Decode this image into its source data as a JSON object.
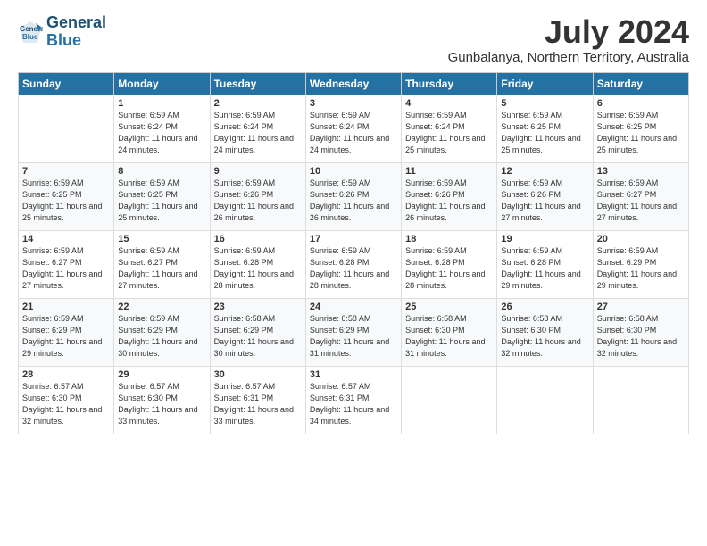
{
  "logo": {
    "line1": "General",
    "line2": "Blue"
  },
  "title": "July 2024",
  "subtitle": "Gunbalanya, Northern Territory, Australia",
  "calendar": {
    "headers": [
      "Sunday",
      "Monday",
      "Tuesday",
      "Wednesday",
      "Thursday",
      "Friday",
      "Saturday"
    ],
    "weeks": [
      [
        {
          "day": "",
          "detail": ""
        },
        {
          "day": "1",
          "detail": "Sunrise: 6:59 AM\nSunset: 6:24 PM\nDaylight: 11 hours\nand 24 minutes."
        },
        {
          "day": "2",
          "detail": "Sunrise: 6:59 AM\nSunset: 6:24 PM\nDaylight: 11 hours\nand 24 minutes."
        },
        {
          "day": "3",
          "detail": "Sunrise: 6:59 AM\nSunset: 6:24 PM\nDaylight: 11 hours\nand 24 minutes."
        },
        {
          "day": "4",
          "detail": "Sunrise: 6:59 AM\nSunset: 6:24 PM\nDaylight: 11 hours\nand 25 minutes."
        },
        {
          "day": "5",
          "detail": "Sunrise: 6:59 AM\nSunset: 6:25 PM\nDaylight: 11 hours\nand 25 minutes."
        },
        {
          "day": "6",
          "detail": "Sunrise: 6:59 AM\nSunset: 6:25 PM\nDaylight: 11 hours\nand 25 minutes."
        }
      ],
      [
        {
          "day": "7",
          "detail": "Sunrise: 6:59 AM\nSunset: 6:25 PM\nDaylight: 11 hours\nand 25 minutes."
        },
        {
          "day": "8",
          "detail": "Sunrise: 6:59 AM\nSunset: 6:25 PM\nDaylight: 11 hours\nand 25 minutes."
        },
        {
          "day": "9",
          "detail": "Sunrise: 6:59 AM\nSunset: 6:26 PM\nDaylight: 11 hours\nand 26 minutes."
        },
        {
          "day": "10",
          "detail": "Sunrise: 6:59 AM\nSunset: 6:26 PM\nDaylight: 11 hours\nand 26 minutes."
        },
        {
          "day": "11",
          "detail": "Sunrise: 6:59 AM\nSunset: 6:26 PM\nDaylight: 11 hours\nand 26 minutes."
        },
        {
          "day": "12",
          "detail": "Sunrise: 6:59 AM\nSunset: 6:26 PM\nDaylight: 11 hours\nand 27 minutes."
        },
        {
          "day": "13",
          "detail": "Sunrise: 6:59 AM\nSunset: 6:27 PM\nDaylight: 11 hours\nand 27 minutes."
        }
      ],
      [
        {
          "day": "14",
          "detail": "Sunrise: 6:59 AM\nSunset: 6:27 PM\nDaylight: 11 hours\nand 27 minutes."
        },
        {
          "day": "15",
          "detail": "Sunrise: 6:59 AM\nSunset: 6:27 PM\nDaylight: 11 hours\nand 27 minutes."
        },
        {
          "day": "16",
          "detail": "Sunrise: 6:59 AM\nSunset: 6:28 PM\nDaylight: 11 hours\nand 28 minutes."
        },
        {
          "day": "17",
          "detail": "Sunrise: 6:59 AM\nSunset: 6:28 PM\nDaylight: 11 hours\nand 28 minutes."
        },
        {
          "day": "18",
          "detail": "Sunrise: 6:59 AM\nSunset: 6:28 PM\nDaylight: 11 hours\nand 28 minutes."
        },
        {
          "day": "19",
          "detail": "Sunrise: 6:59 AM\nSunset: 6:28 PM\nDaylight: 11 hours\nand 29 minutes."
        },
        {
          "day": "20",
          "detail": "Sunrise: 6:59 AM\nSunset: 6:29 PM\nDaylight: 11 hours\nand 29 minutes."
        }
      ],
      [
        {
          "day": "21",
          "detail": "Sunrise: 6:59 AM\nSunset: 6:29 PM\nDaylight: 11 hours\nand 29 minutes."
        },
        {
          "day": "22",
          "detail": "Sunrise: 6:59 AM\nSunset: 6:29 PM\nDaylight: 11 hours\nand 30 minutes."
        },
        {
          "day": "23",
          "detail": "Sunrise: 6:58 AM\nSunset: 6:29 PM\nDaylight: 11 hours\nand 30 minutes."
        },
        {
          "day": "24",
          "detail": "Sunrise: 6:58 AM\nSunset: 6:29 PM\nDaylight: 11 hours\nand 31 minutes."
        },
        {
          "day": "25",
          "detail": "Sunrise: 6:58 AM\nSunset: 6:30 PM\nDaylight: 11 hours\nand 31 minutes."
        },
        {
          "day": "26",
          "detail": "Sunrise: 6:58 AM\nSunset: 6:30 PM\nDaylight: 11 hours\nand 32 minutes."
        },
        {
          "day": "27",
          "detail": "Sunrise: 6:58 AM\nSunset: 6:30 PM\nDaylight: 11 hours\nand 32 minutes."
        }
      ],
      [
        {
          "day": "28",
          "detail": "Sunrise: 6:57 AM\nSunset: 6:30 PM\nDaylight: 11 hours\nand 32 minutes."
        },
        {
          "day": "29",
          "detail": "Sunrise: 6:57 AM\nSunset: 6:30 PM\nDaylight: 11 hours\nand 33 minutes."
        },
        {
          "day": "30",
          "detail": "Sunrise: 6:57 AM\nSunset: 6:31 PM\nDaylight: 11 hours\nand 33 minutes."
        },
        {
          "day": "31",
          "detail": "Sunrise: 6:57 AM\nSunset: 6:31 PM\nDaylight: 11 hours\nand 34 minutes."
        },
        {
          "day": "",
          "detail": ""
        },
        {
          "day": "",
          "detail": ""
        },
        {
          "day": "",
          "detail": ""
        }
      ]
    ]
  }
}
